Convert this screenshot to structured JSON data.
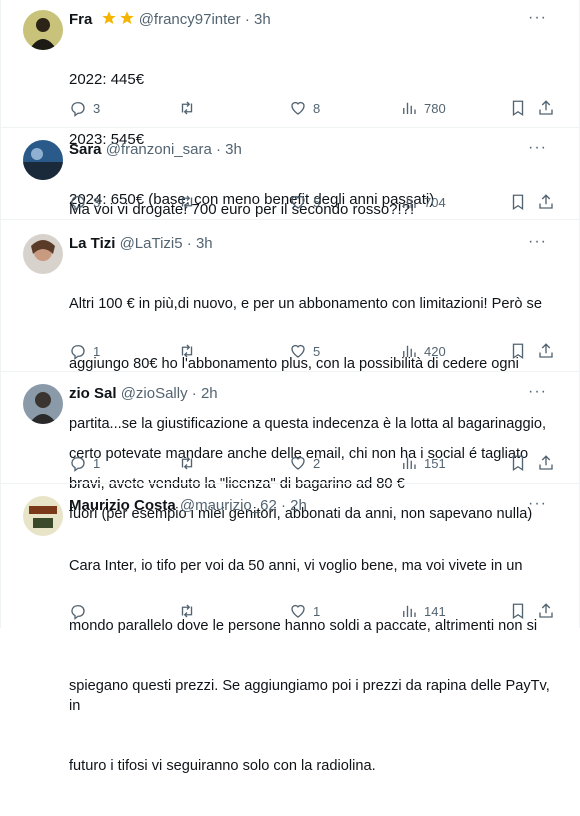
{
  "tweets": [
    {
      "name": "Fra",
      "handle": "@francy97inter",
      "time": "3h",
      "lines": [
        "2022: 445€",
        "2023: 545€",
        "2024: 650€ (base, con meno benefit degli anni passati)"
      ],
      "replies": "3",
      "retweets": "",
      "likes": "8",
      "views": "780"
    },
    {
      "name": "Sara",
      "handle": "@franzoni_sara",
      "time": "3h",
      "lines": [
        "Ma voi vi drogate! 700 euro per il secondo rosso?!?!"
      ],
      "replies": "3",
      "retweets": "",
      "likes": "5",
      "views": "704"
    },
    {
      "name": "La Tizi",
      "handle": "@LaTizi5",
      "time": "3h",
      "lines": [
        "Altri 100 € in più,di nuovo, e per un abbonamento con limitazioni! Però se",
        "aggiungo 80€ ho l'abbonamento plus, con la possibilità di cedere ogni",
        "partita...se la giustificazione a questa indecenza è la lotta al bagarinaggio,",
        "bravi, avete venduto la \"licenza\" di bagarino ad 80 €"
      ],
      "replies": "1",
      "retweets": "",
      "likes": "5",
      "views": "420"
    },
    {
      "name": "zio Sal",
      "handle": "@zioSally",
      "time": "2h",
      "lines": [
        "certo potevate mandare anche delle email, chi non ha i social é tagliato",
        "fuori (per esempio i miei genitori, abbonati da anni, non sapevano nulla)"
      ],
      "replies": "1",
      "retweets": "",
      "likes": "2",
      "views": "151"
    },
    {
      "name": "Maurizio Costa",
      "handle": "@maurizio_62",
      "time": "2h",
      "lines": [
        "Cara Inter, io tifo per voi da 50 anni, vi voglio bene, ma voi vivete in un",
        "mondo parallelo dove le persone hanno soldi a paccate, altrimenti non si",
        "spiegano questi prezzi. Se aggiungiamo poi i prezzi da rapina delle PayTv, in",
        "futuro i tifosi vi seguiranno solo con la radiolina."
      ],
      "replies": "",
      "retweets": "",
      "likes": "1",
      "views": "141"
    }
  ],
  "separator_dot": "·",
  "more_glyph": "···",
  "colors": {
    "text": "#0f1419",
    "secondary": "#536471",
    "border": "#eff3f4",
    "star": "#f4b400"
  },
  "icons": [
    "reply-icon",
    "retweet-icon",
    "like-icon",
    "views-icon",
    "bookmark-icon",
    "share-icon",
    "more-icon",
    "star-icon"
  ]
}
